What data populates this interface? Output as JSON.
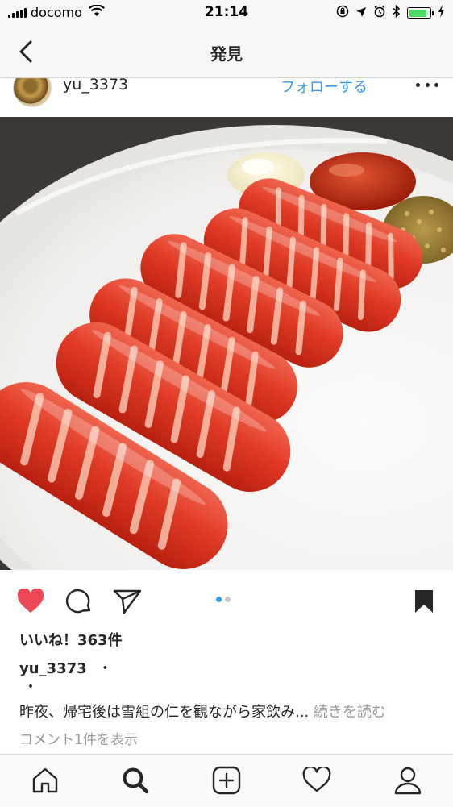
{
  "status_bar": {
    "carrier": "docomo",
    "time": "21:14",
    "battery_level": 0.85,
    "battery_color": "#4cd964"
  },
  "nav": {
    "title": "発見",
    "back_icon": "chevron-left-icon"
  },
  "post": {
    "username": "yu_3373",
    "follow_label": "フォローする",
    "more_icon": "more-horizontal-icon",
    "photo_subject": "grilled-sausages-plate",
    "actions": {
      "like_icon": "heart-filled-icon",
      "comment_icon": "comment-icon",
      "share_icon": "send-icon",
      "save_icon": "bookmark-filled-icon"
    },
    "carousel": {
      "total": 2,
      "current": 1,
      "active_color": "#3897f0",
      "inactive_color": "#c7c7c7"
    },
    "likes_text": "いいね！363件",
    "caption_username": "yu_3373",
    "caption_suffix": "・",
    "caption_second_line": "・",
    "caption_text": "昨夜、帰宅後は雪組の仁を観ながら家飲み...",
    "read_more": "続きを読む",
    "comments_link": "コメント1件を表示"
  },
  "tab_bar": {
    "tabs": [
      "home-icon",
      "search-icon",
      "add-post-icon",
      "activity-heart-icon",
      "profile-icon"
    ],
    "active": "search-icon"
  },
  "colors": {
    "like_red": "#ed4956",
    "link_blue": "#3897f0",
    "muted_text": "#999999"
  }
}
